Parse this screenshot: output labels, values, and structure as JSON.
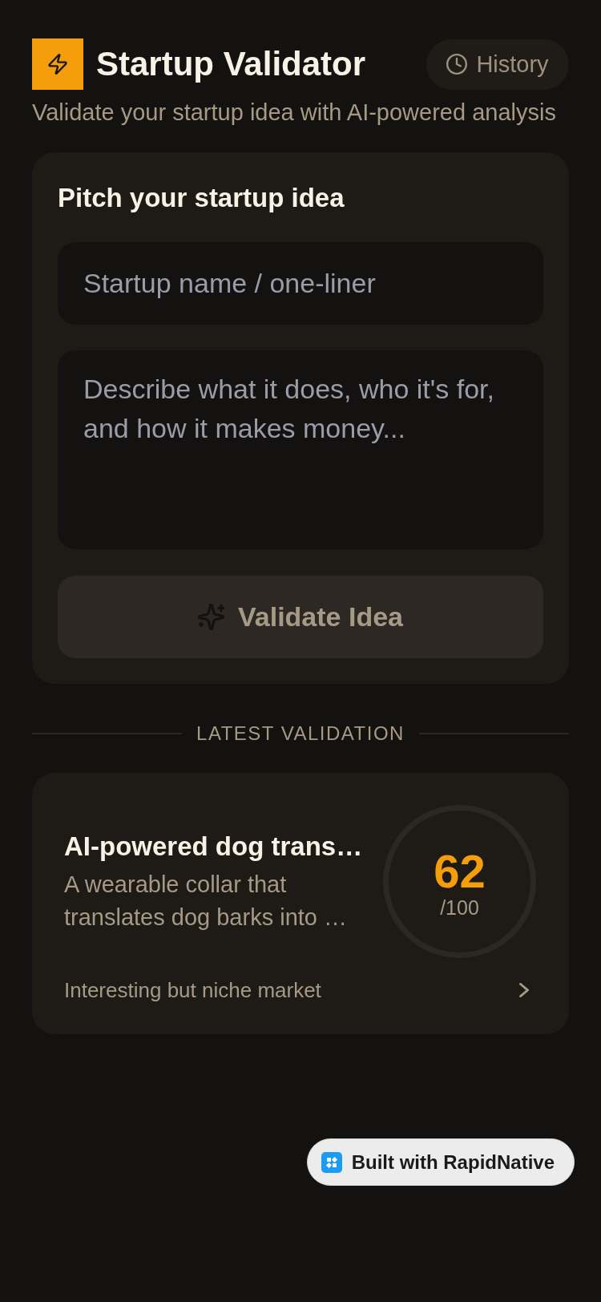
{
  "header": {
    "title": "Startup Validator",
    "history_button": "History",
    "subtitle": "Validate your startup idea with AI-powered analysis"
  },
  "pitch_form": {
    "heading": "Pitch your startup idea",
    "name_field": {
      "placeholder": "Startup name / one-liner"
    },
    "description_field": {
      "placeholder": "Describe what it does, who it's for, and how it makes money..."
    },
    "validate_button": {
      "label": "Validate Idea",
      "disabled": true
    }
  },
  "latest_validation": {
    "section_label": "LATEST VALIDATION",
    "title": "AI-powered dog trans…",
    "description": "A wearable collar that translates dog barks into …",
    "score": "62",
    "score_max": "/100",
    "verdict": "Interesting but niche market"
  },
  "badge": {
    "label": "Built with RapidNative"
  }
}
